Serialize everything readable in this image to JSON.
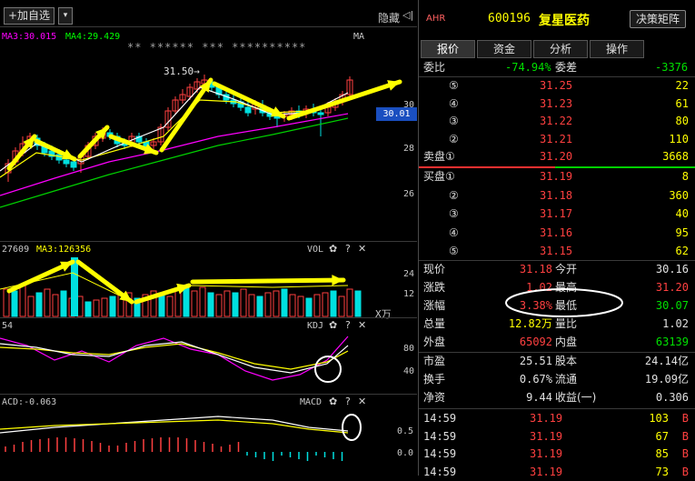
{
  "toolbar": {
    "add_label": "+加自选",
    "dropdown_icon": "▾",
    "hide_label": "隐藏",
    "hide_arrow": "◁|"
  },
  "kline": {
    "ma_legend": {
      "ma3": "MA3:30.015",
      "ma4": "MA4:29.429",
      "ma": "MA"
    },
    "stars": "** ****** *** **********",
    "high_label": "31.50→",
    "price_axis": [
      "30",
      "28",
      "26"
    ],
    "current_price": "30.01"
  },
  "volume": {
    "legend_left": "27609",
    "legend_ma": "MA3:126356",
    "title": "VOL",
    "axis": [
      "24",
      "12"
    ],
    "unit": "X万"
  },
  "kdj": {
    "legend_left": "54",
    "title": "KDJ",
    "axis": [
      "80",
      "40"
    ]
  },
  "macd": {
    "legend_left": "ACD:-0.063",
    "title": "MACD",
    "axis": [
      "0.5",
      "0.0"
    ]
  },
  "controls": {
    "gear": "✿",
    "help": "?",
    "close": "✕"
  },
  "stock": {
    "badge": "AHR",
    "code": "600196",
    "name": "复星医药",
    "decision_button": "决策矩阵",
    "tabs": [
      "报价",
      "资金",
      "分析",
      "操作"
    ]
  },
  "bid_summary": {
    "weibi_label": "委比",
    "weibi_value": "-74.94%",
    "weicha_label": "委差",
    "weicha_value": "-3376"
  },
  "sell_orders": [
    {
      "level": "⑤",
      "price": "31.25",
      "vol": "22"
    },
    {
      "level": "④",
      "price": "31.23",
      "vol": "61"
    },
    {
      "level": "③",
      "price": "31.22",
      "vol": "80"
    },
    {
      "level": "②",
      "price": "31.21",
      "vol": "110"
    },
    {
      "level": "卖盘①",
      "price": "31.20",
      "vol": "3668"
    }
  ],
  "buy_orders": [
    {
      "level": "买盘①",
      "price": "31.19",
      "vol": "8"
    },
    {
      "level": "②",
      "price": "31.18",
      "vol": "360"
    },
    {
      "level": "③",
      "price": "31.17",
      "vol": "40"
    },
    {
      "level": "④",
      "price": "31.16",
      "vol": "95"
    },
    {
      "level": "⑤",
      "price": "31.15",
      "vol": "62"
    }
  ],
  "quote": [
    {
      "l1": "现价",
      "v1": "31.18",
      "l2": "今开",
      "v2": "30.16",
      "c1": "red",
      "c2": "white"
    },
    {
      "l1": "涨跌",
      "v1": "1.02",
      "l2": "最高",
      "v2": "31.20",
      "c1": "red",
      "c2": "red"
    },
    {
      "l1": "涨幅",
      "v1": "3.38%",
      "l2": "最低",
      "v2": "30.07",
      "c1": "red",
      "c2": "green"
    },
    {
      "l1": "总量",
      "v1": "12.82万",
      "l2": "量比",
      "v2": "1.02",
      "c1": "yellow",
      "c2": "white"
    },
    {
      "l1": "外盘",
      "v1": "65092",
      "l2": "内盘",
      "v2": "63139",
      "c1": "red",
      "c2": "green"
    }
  ],
  "fundamentals": [
    {
      "l1": "市盈",
      "v1": "25.51",
      "l2": "股本",
      "v2": "24.14亿"
    },
    {
      "l1": "换手",
      "v1": "0.67%",
      "l2": "流通",
      "v2": "19.09亿"
    },
    {
      "l1": "净资",
      "v1": "9.44",
      "l2": "收益(一)",
      "v2": "0.306"
    }
  ],
  "ticks": [
    {
      "time": "14:59",
      "price": "31.19",
      "vol": "103",
      "side": "B"
    },
    {
      "time": "14:59",
      "price": "31.19",
      "vol": "67",
      "side": "B"
    },
    {
      "time": "14:59",
      "price": "31.19",
      "vol": "85",
      "side": "B"
    },
    {
      "time": "14:59",
      "price": "31.19",
      "vol": "73",
      "side": "B"
    }
  ],
  "colors": {
    "up": "#ff4040",
    "down": "#00e0e0",
    "accent": "#ffff00",
    "ma_white": "#ffffff",
    "ma_yellow": "#ffff00",
    "ma_magenta": "#ff00ff",
    "ma_green": "#00d000"
  }
}
